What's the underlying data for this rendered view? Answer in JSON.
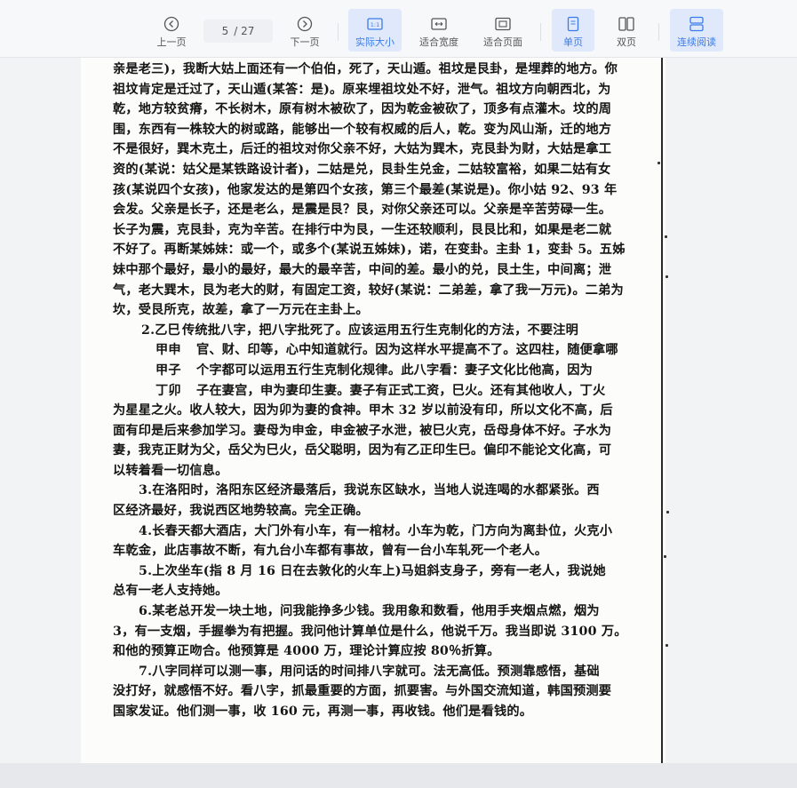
{
  "toolbar": {
    "prev_label": "上一页",
    "current_page": "5",
    "total_pages": "/ 27",
    "next_label": "下一页",
    "actual_size_label": "实际大小",
    "actual_size_badge": "1:1",
    "fit_width_label": "适合宽度",
    "fit_page_label": "适合页面",
    "single_page_label": "单页",
    "double_page_label": "双页",
    "continuous_label": "连续阅读",
    "accent_color": "#3a7bea"
  },
  "document": {
    "lines": [
      "亲是老三)，我断大姑上面还有一个伯伯，死了，天山遁。祖坟是艮卦，是埋葬的地方。你",
      "祖坟肯定是迁过了，天山遁(某答：是)。原来埋祖坟处不好，泄气。祖坟方向朝西北，为",
      "乾，地方较贫瘠，不长树木，原有树木被砍了，因为乾金被砍了，顶多有点灌木。坟的周",
      "围，东西有一株较大的树或路，能够出一个较有权威的后人，乾。变为风山渐，迁的地方",
      "不是很好，巽木克土，后迁的祖坟对你父亲不好，大姑为巽木，克艮卦为财，大姑是拿工",
      "资的(某说：姑父是某铁路设计者)，二姑是兑，艮卦生兑金，二姑较富裕，如果二姑有女",
      "孩(某说四个女孩)，他家发达的是第四个女孩，第三个最差(某说是)。你小姑 92、93 年",
      "会发。父亲是长子，还是老么，是震是艮？艮，对你父亲还可以。父亲是辛苦劳碌一生。",
      "长子为震，克艮卦，克为辛苦。在排行中为艮，一生还较顺利，艮艮比和，如果是老二就",
      "不好了。再断某姊妹：或一个，或多个(某说五姊妹)，诺，在变卦。主卦 1，变卦 5。五姊",
      "妹中那个最好，最小的最好，最大的最辛苦，中间的差。最小的兑，艮土生，中间离；泄",
      "气，老大巽木，艮为老大的财，有固定工资，较好(某说：二弟差，拿了我一万元)。二弟为",
      "坎，受艮所克，故差，拿了一万元在主卦上。"
    ],
    "bazi_block": [
      {
        "key": "2.乙巳",
        "text": "传统批八字，把八字批死了。应该运用五行生克制化的方法，不要注明"
      },
      {
        "key": "甲申",
        "text": "官、财、印等，心中知道就行。因为这样水平提高不了。这四柱，随便拿哪"
      },
      {
        "key": "甲子",
        "text": "个字都可以运用五行生克制化规律。此八字看：妻子文化比他高，因为"
      },
      {
        "key": "丁卯",
        "text": "子在妻宫，申为妻印生妻。妻子有正式工资，巳火。还有其他收人，丁火"
      }
    ],
    "lines_after": [
      "为星星之火。收人较大，因为卯为妻的食神。甲木 32 岁以前没有印，所以文化不高，后",
      "面有印是后来参加学习。妻母为申金，申金被子水泄，被巳火克，岳母身体不好。子水为",
      "妻，我克正财为父，岳父为巳火，岳父聪明，因为有乙正印生巳。偏印不能论文化高，可",
      "以转着看一切信息。"
    ],
    "items": [
      {
        "first": "3.在洛阳时，洛阳东区经济最落后，我说东区缺水，当地人说连喝的水都紧张。西",
        "rest": [
          "区经济最好，我说西区地势较高。完全正确。"
        ]
      },
      {
        "first": "4.长春天都大酒店，大门外有小车，有一棺材。小车为乾，门方向为离卦位，火克小",
        "rest": [
          "车乾金，此店事故不断，有九台小车都有事故，曾有一台小车轧死一个老人。"
        ]
      },
      {
        "first": "5.上次坐车(指 8 月 16 日在去敦化的火车上)马姐斜支身子，旁有一老人，我说她",
        "rest": [
          "总有一老人支持她。"
        ]
      },
      {
        "first": "6.某老总开发一块土地，问我能挣多少钱。我用象和数看，他用手夹烟点燃，烟为",
        "rest": [
          "3，有一支烟，手握拳为有把握。我问他计算单位是什么，他说千万。我当即说 3100 万。",
          "和他的预算正吻合。他预算是 4000 万，理论计算应按 80％折算。"
        ]
      },
      {
        "first": "7.八字同样可以测一事，用问话的时间排八字就可。法无高低。预测靠感悟，基础",
        "rest": [
          "没打好，就感悟不好。看八字，抓最重要的方面，抓要害。与外国交流知道，韩国预测要",
          "国家发证。他们测一事，收 160 元，再测一事，再收钱。他们是看钱的。"
        ]
      }
    ]
  }
}
